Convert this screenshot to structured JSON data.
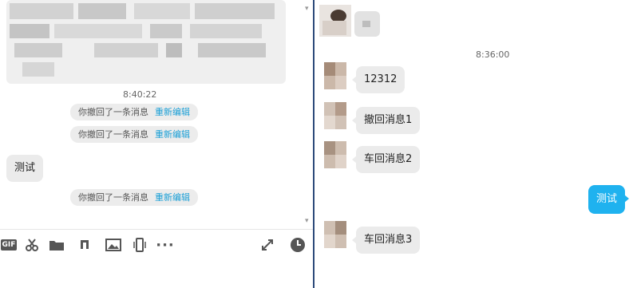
{
  "left": {
    "time": "8:40:22",
    "recall_text": "你撤回了一条消息",
    "edit_text": "重新编辑",
    "messages": [
      {
        "text": "测试"
      }
    ]
  },
  "toolbar": {
    "gif_label": "GIF",
    "more_label": "···"
  },
  "right": {
    "time": "8:36:00",
    "messages": [
      {
        "text": "12312"
      },
      {
        "text": "撤回消息1"
      },
      {
        "text": "车回消息2"
      },
      {
        "text": "测试"
      },
      {
        "text": "车回消息3"
      }
    ]
  },
  "colors": {
    "accent": "#1fb2ef",
    "edit_link": "#1a9fd6",
    "divider": "#2c4a7a",
    "bubble_gray": "#ebebeb"
  }
}
